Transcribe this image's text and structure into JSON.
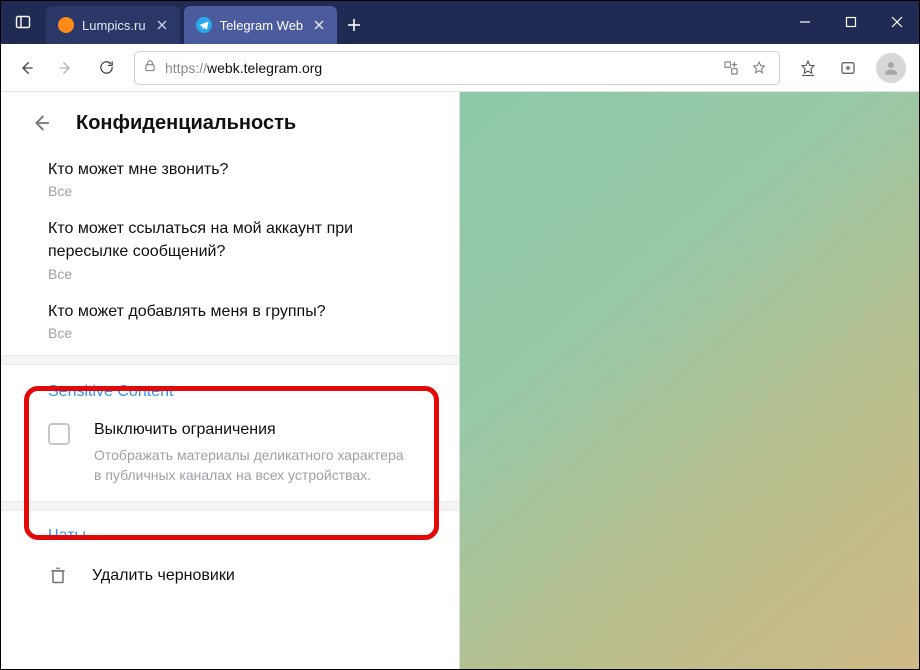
{
  "titlebar": {
    "tabs": [
      {
        "label": "Lumpics.ru"
      },
      {
        "label": "Telegram Web"
      }
    ]
  },
  "toolbar": {
    "url_scheme": "https://",
    "url_host": "webk.telegram.org"
  },
  "panel": {
    "title": "Конфиденциальность",
    "items": [
      {
        "q": "Кто может мне звонить?",
        "v": "Все"
      },
      {
        "q": "Кто может ссылаться на мой аккаунт при пересылке сообщений?",
        "v": "Все"
      },
      {
        "q": "Кто может добавлять меня в группы?",
        "v": "Все"
      }
    ],
    "sensitive": {
      "section_title": "Sensitive Content",
      "label": "Выключить ограничения",
      "desc": "Отображать материалы деликатного характера в публичных каналах на всех устройствах."
    },
    "chats": {
      "section_title": "Чаты",
      "delete_drafts": "Удалить черновики"
    }
  }
}
